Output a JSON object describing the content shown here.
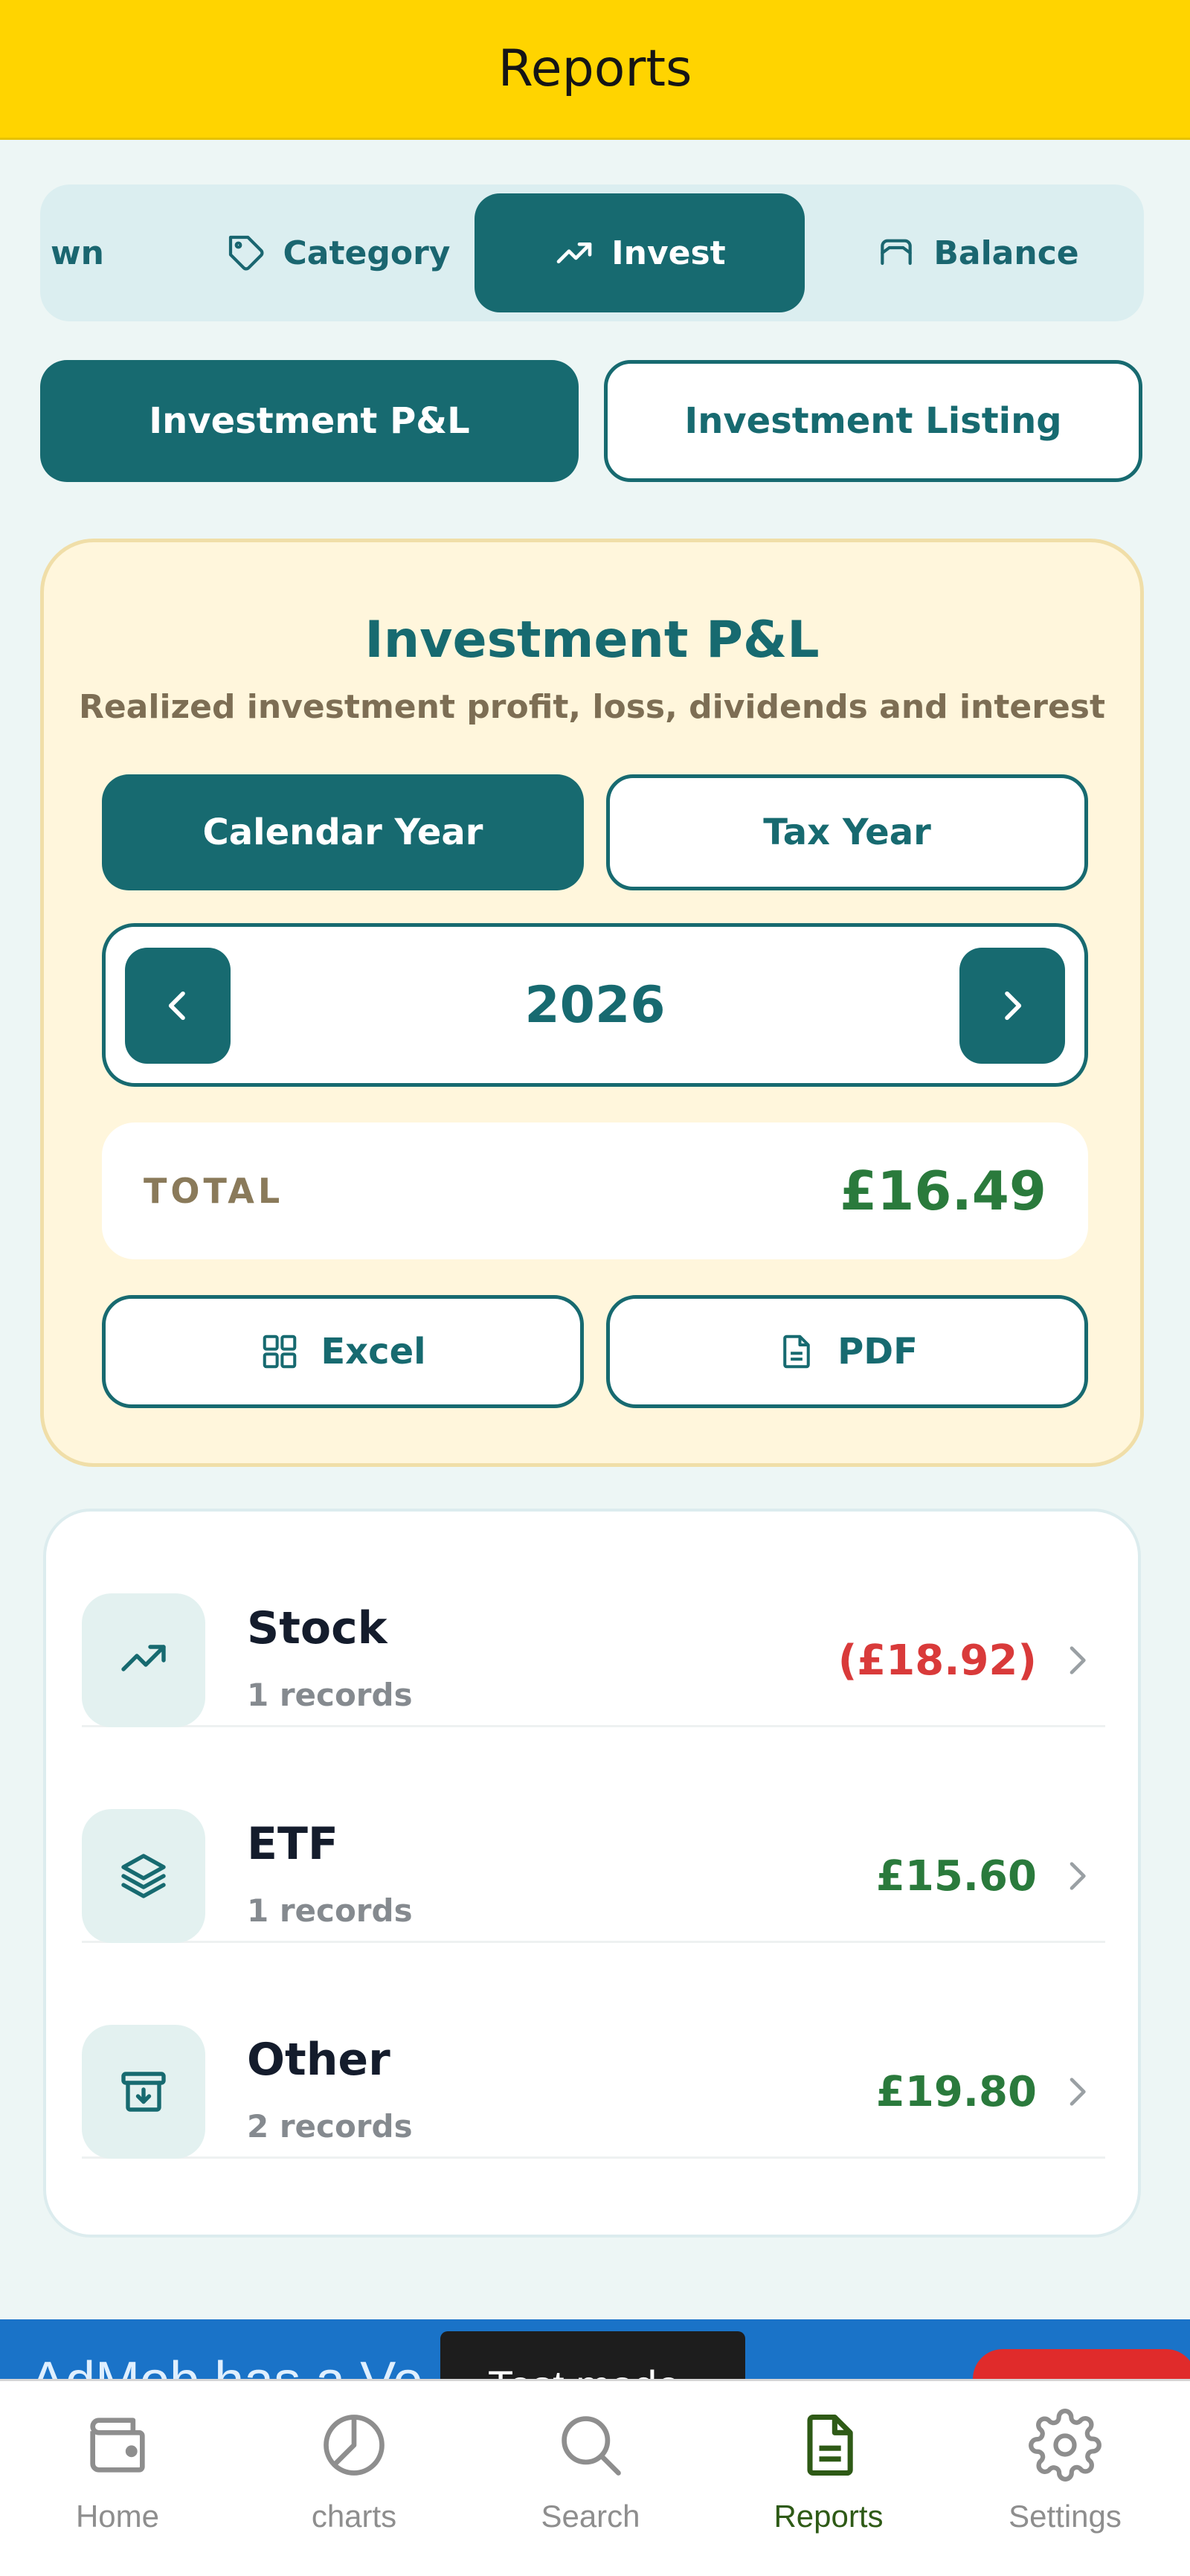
{
  "header": {
    "title": "Reports"
  },
  "report_tabs": [
    {
      "label": "wn",
      "icon": "overview-icon"
    },
    {
      "label": "Category",
      "icon": "tag-icon"
    },
    {
      "label": "Invest",
      "icon": "trending-up-icon",
      "active": true
    },
    {
      "label": "Balance",
      "icon": "balance-icon"
    }
  ],
  "subtabs": {
    "active": "Investment P&L",
    "inactive": "Investment Listing"
  },
  "pl_card": {
    "title": "Investment P&L",
    "subtitle": "Realized investment profit, loss, dividends and interest",
    "calendar_year_label": "Calendar Year",
    "tax_year_label": "Tax Year",
    "year": "2026",
    "total_label": "TOTAL",
    "total_value": "£16.49",
    "excel_label": "Excel",
    "pdf_label": "PDF"
  },
  "list": [
    {
      "name": "Stock",
      "records": "1 records",
      "amount": "(£18.92)",
      "amount_color": "#d93a3a",
      "icon": "trending-up-icon"
    },
    {
      "name": "ETF",
      "records": "1 records",
      "amount": "£15.60",
      "amount_color": "#2a7a3c",
      "icon": "layers-icon"
    },
    {
      "name": "Other",
      "records": "2 records",
      "amount": "£19.80",
      "amount_color": "#2a7a3c",
      "icon": "archive-icon"
    }
  ],
  "ad": {
    "text": "AdMob has a Vo",
    "label": "Test mode"
  },
  "tabbar": [
    {
      "label": "Home",
      "icon": "wallet-icon"
    },
    {
      "label": "charts",
      "icon": "pie-chart-icon"
    },
    {
      "label": "Search",
      "icon": "search-icon"
    },
    {
      "label": "Reports",
      "icon": "document-icon",
      "active": true
    },
    {
      "label": "Settings",
      "icon": "gear-icon"
    }
  ],
  "colors": {
    "header_bg": "#ffd400",
    "primary": "#176a70",
    "positive": "#2a7a3c",
    "negative": "#d93a3a",
    "card_bg": "#fff6dc",
    "active_tab": "#2e5a16"
  }
}
